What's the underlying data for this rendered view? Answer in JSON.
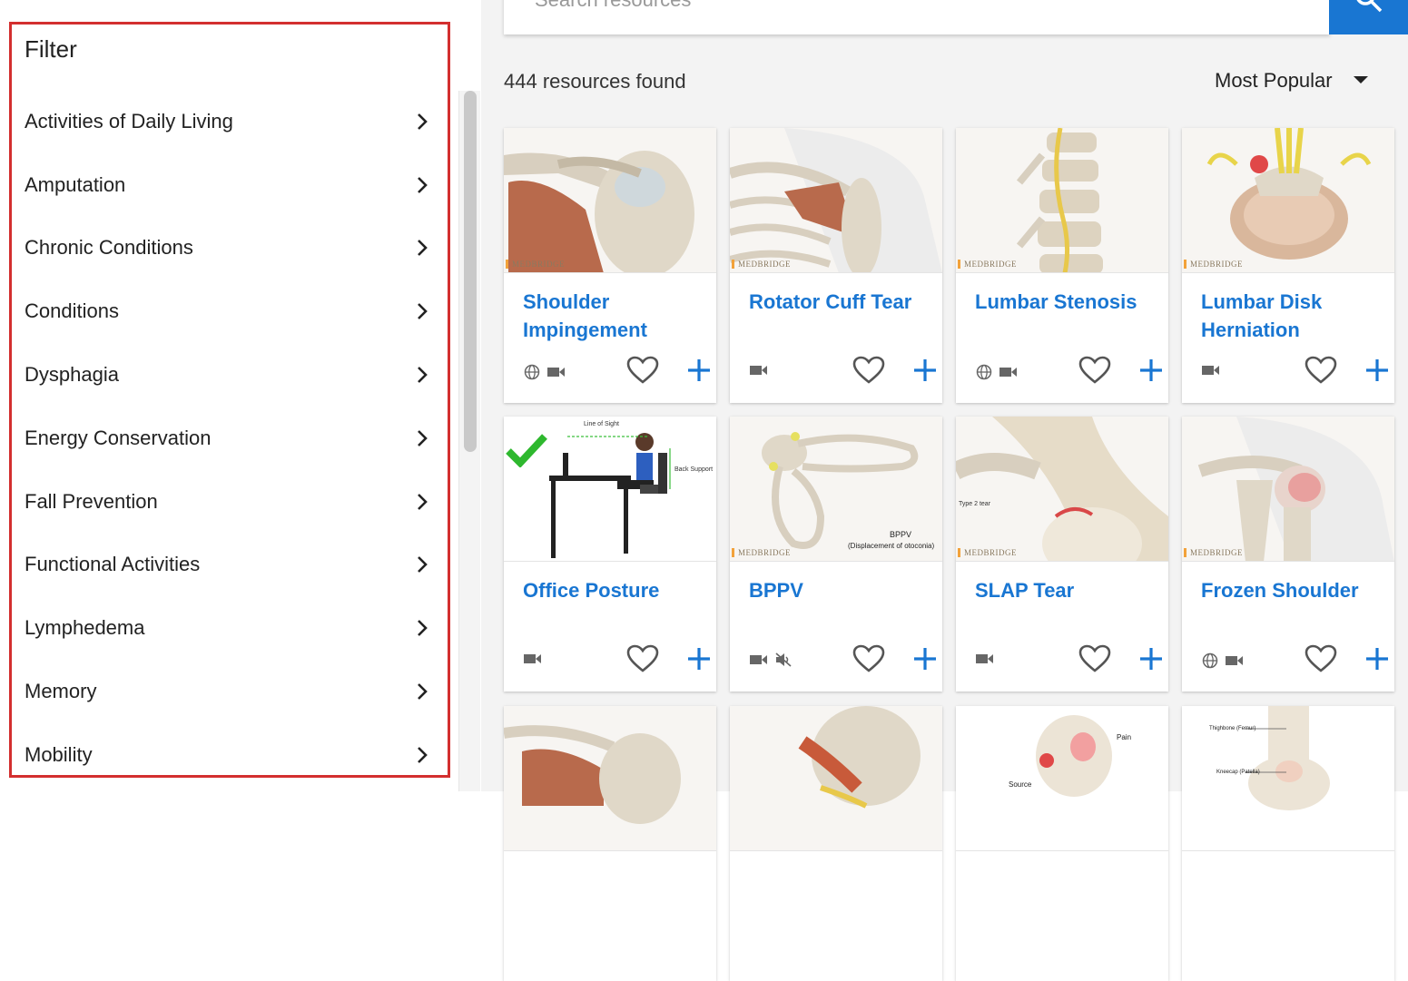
{
  "sidebar": {
    "title": "Filter",
    "items": [
      {
        "label": "Activities of Daily Living"
      },
      {
        "label": "Amputation"
      },
      {
        "label": "Chronic Conditions"
      },
      {
        "label": "Conditions"
      },
      {
        "label": "Dysphagia"
      },
      {
        "label": "Energy Conservation"
      },
      {
        "label": "Fall Prevention"
      },
      {
        "label": "Functional Activities"
      },
      {
        "label": "Lymphedema"
      },
      {
        "label": "Memory"
      },
      {
        "label": "Mobility"
      }
    ]
  },
  "search": {
    "placeholder": "Search resources"
  },
  "results": {
    "count_text": "444 resources found",
    "sort_label": "Most Popular"
  },
  "watermark": "MEDBRIDGE",
  "colors": {
    "accent": "#1976d2",
    "highlight_border": "#d32f2f",
    "check": "#2eb82e"
  },
  "cards": [
    {
      "title": "Shoulder Impingement",
      "media": [
        "globe-icon",
        "video-icon"
      ]
    },
    {
      "title": "Rotator Cuff Tear",
      "media": [
        "video-icon"
      ]
    },
    {
      "title": "Lumbar Stenosis",
      "media": [
        "globe-icon",
        "video-icon"
      ]
    },
    {
      "title": "Lumbar Disk Herniation",
      "media": [
        "video-icon"
      ]
    },
    {
      "title": "Office Posture",
      "media": [
        "video-icon"
      ],
      "checked": true,
      "thumb_labels": {
        "a": "Line of Sight",
        "b": "Back Support"
      }
    },
    {
      "title": "BPPV",
      "media": [
        "video-icon",
        "muted-icon"
      ],
      "thumb_labels": {
        "a": "BPPV",
        "b": "(Displacement of otoconia)"
      }
    },
    {
      "title": "SLAP Tear",
      "media": [
        "video-icon"
      ],
      "thumb_labels": {
        "a": "Type 2 tear"
      }
    },
    {
      "title": "Frozen Shoulder",
      "media": [
        "globe-icon",
        "video-icon"
      ]
    },
    {
      "title": "",
      "media": []
    },
    {
      "title": "",
      "media": []
    },
    {
      "title": "",
      "media": [],
      "thumb_labels": {
        "a": "Pain",
        "b": "Source"
      }
    },
    {
      "title": "",
      "media": [],
      "thumb_labels": {
        "a": "Thighbone (Femur)",
        "b": "Kneecap (Patella)"
      }
    }
  ]
}
